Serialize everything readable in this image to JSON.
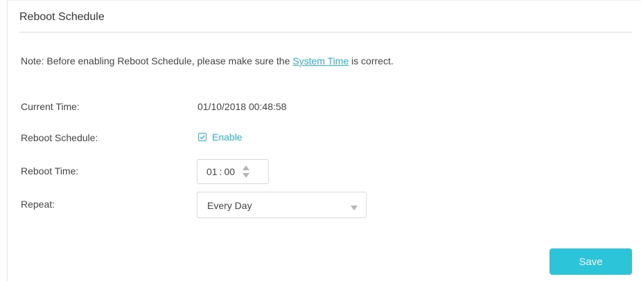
{
  "section": {
    "title": "Reboot Schedule"
  },
  "note": {
    "prefix": "Note: Before enabling Reboot Schedule, please make sure the ",
    "link": "System Time",
    "suffix": " is correct."
  },
  "current_time": {
    "label": "Current Time:",
    "value": "01/10/2018 00:48:58"
  },
  "reboot_schedule": {
    "label": "Reboot Schedule:",
    "checkbox_label": "Enable",
    "checked": true
  },
  "reboot_time": {
    "label": "Reboot Time:",
    "hour": "01",
    "separator": ":",
    "minute": "00"
  },
  "repeat": {
    "label": "Repeat:",
    "selected": "Every Day"
  },
  "actions": {
    "save_label": "Save"
  },
  "colors": {
    "accent": "#2bb7d4",
    "save_button": "#2bc4d8",
    "text": "#444444",
    "border": "#d9d9d9"
  },
  "icons": {
    "checkbox": "checkmark-icon",
    "spinner": "up-down-spinner-icon",
    "dropdown": "caret-down-icon"
  }
}
